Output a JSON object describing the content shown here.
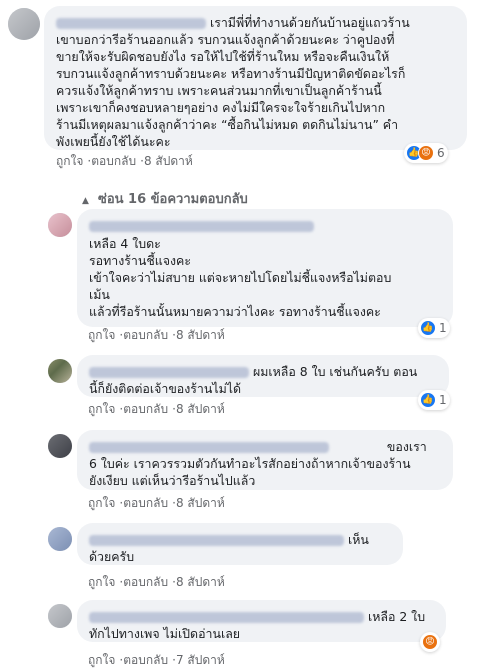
{
  "comments": [
    {
      "lines": [
        "เรามีพี่ที่ทำงานด้วยกันบ้านอยู่แถวร้าน",
        "เขาบอกว่ารีอร้านออกแล้ว รบกวนแจ้งลูกค้าด้วยนะคะ ว่าคูปองที่",
        "ขายให้จะรับผิดชอบยังไง รอให้ไปใช้ที่ร้านใหม หรือจะคืนเงินให้",
        "รบกวนแจ้งลูกค้าทราบด้วยนะคะ หรือทางร้านมีปัญหาติดขัดอะไรก็",
        "ควรแจ้งให้ลูกค้าทราบ เพราะคนส่วนมากที่เขาเป็นลูกค้าร้านนี้",
        "เพราะเขาก็คงชอบหลายๆอย่าง คงไม่มีใครจะใจร้ายเกินไปหาก",
        "ร้านมีเหตุผลมาแจ้งลูกค้าว่าคะ “ซื้อกินไม่หมด ตดกินไม่นาน” คำ",
        "พังเพยนี้ยังใช้ได้นะคะ"
      ],
      "like": "ถูกใจ",
      "reply": "ตอบกลับ",
      "time": "8 สัปดาห์",
      "reaction_count": "6",
      "reactions": [
        "like-icon",
        "angry-icon"
      ]
    }
  ],
  "hide_replies": "ซ่อน 16 ข้อความตอบกลับ",
  "replies": [
    {
      "lines": [
        "เหลือ 4 ใบดะ",
        "รอทางร้านชี้แจงคะ",
        "เข้าใจคะว่าไม่สบาย แต่จะหายไปโดยไม่ชี้แจงหรือไม่ตอบ",
        "เม้น",
        "แล้วที่รีอร้านนั้นหมายความว่าไงคะ รอทางร้านชี้แจงคะ"
      ],
      "like": "ถูกใจ",
      "reply": "ตอบกลับ",
      "time": "8 สัปดาห์",
      "reaction_count": "1"
    },
    {
      "first_line": "ผมเหลือ 8 ใบ เช่นกันครับ ตอน",
      "lines": [
        "นี้ก็ยังติดต่อเจ้าของร้านไม่ได้"
      ],
      "like": "ถูกใจ",
      "reply": "ตอบกลับ",
      "time": "8 สัปดาห์",
      "reaction_count": "1"
    },
    {
      "first_line": "ของเรา",
      "lines": [
        "6 ใบค่ะ เราควรรวมตัวกันทำอะไรสักอย่างถ้าหากเจ้าของร้าน",
        "ยังเงียบ แต่เห็นว่ารีอร้านไปแล้ว"
      ],
      "like": "ถูกใจ",
      "reply": "ตอบกลับ",
      "time": "8 สัปดาห์"
    },
    {
      "first_line": "เห็น",
      "lines": [
        "ด้วยครับ"
      ],
      "like": "ถูกใจ",
      "reply": "ตอบกลับ",
      "time": "8 สัปดาห์"
    },
    {
      "first_line": "เหลือ 2 ใบ",
      "lines": [
        "ทักไปทางเพจ ไม่เปิดอ่านเลย"
      ],
      "like": "ถูกใจ",
      "reply": "ตอบกลับ",
      "time": "7 สัปดาห์",
      "reactions": [
        "angry-icon"
      ]
    }
  ],
  "dot": "·",
  "colors": {
    "like": "#1877f2",
    "angry": "#e9710f",
    "bubble": "#f0f2f5",
    "meta": "#65676b"
  }
}
